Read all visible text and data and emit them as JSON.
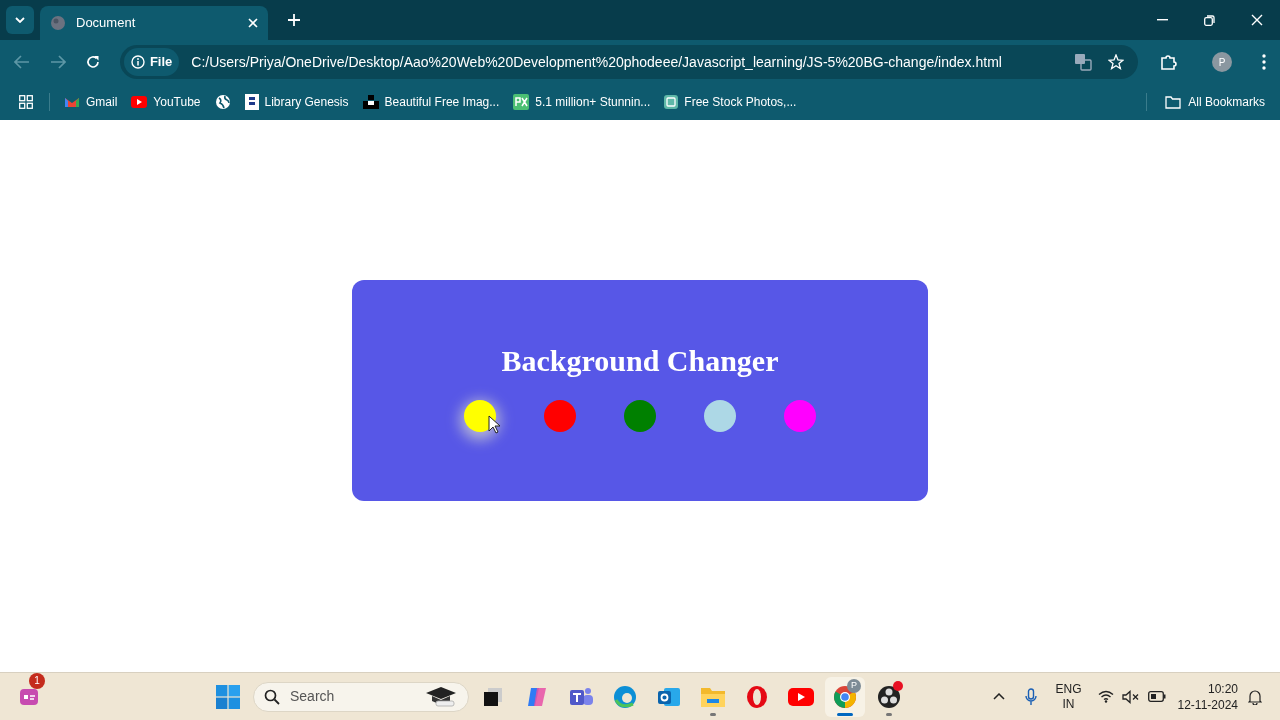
{
  "browser": {
    "tab": {
      "title": "Document"
    },
    "address": {
      "scheme": "File",
      "url": "C:/Users/Priya/OneDrive/Desktop/Aao%20Web%20Development%20phodeee/Javascript_learning/JS-5%20BG-change/index.html"
    },
    "profile": "P",
    "bookmarks": [
      {
        "kind": "gmail",
        "label": "Gmail"
      },
      {
        "kind": "youtube",
        "label": "YouTube"
      },
      {
        "kind": "globe"
      },
      {
        "kind": "book",
        "label": "Library Genesis"
      },
      {
        "kind": "unsplash",
        "label": "Beautiful Free Imag..."
      },
      {
        "kind": "px",
        "label": "5.1 million+ Stunnin..."
      },
      {
        "kind": "stock",
        "label": "Free Stock Photos,..."
      }
    ],
    "all_bookmarks": "All Bookmarks"
  },
  "card": {
    "title": "Background Changer",
    "swatches": [
      {
        "color": "#ffff00",
        "hovered": true
      },
      {
        "color": "#ff0000",
        "hovered": false
      },
      {
        "color": "#008000",
        "hovered": false
      },
      {
        "color": "#add8e6",
        "hovered": false
      },
      {
        "color": "#ff00ff",
        "hovered": false
      }
    ]
  },
  "taskbar": {
    "widget_badge": "1",
    "search": {
      "placeholder": "Search"
    },
    "apps": [
      {
        "kind": "taskview",
        "running": false,
        "active": false
      },
      {
        "kind": "copilot",
        "running": false,
        "active": false
      },
      {
        "kind": "teams",
        "running": false,
        "active": false
      },
      {
        "kind": "edge",
        "running": false,
        "active": false
      },
      {
        "kind": "outlook",
        "running": false,
        "active": false
      },
      {
        "kind": "folder",
        "running": true,
        "active": false
      },
      {
        "kind": "opera",
        "running": false,
        "active": false
      },
      {
        "kind": "youtube",
        "running": false,
        "active": false
      },
      {
        "kind": "chrome",
        "running": true,
        "active": true,
        "badge": "P"
      },
      {
        "kind": "obs",
        "running": true,
        "active": false
      }
    ],
    "language": "ENG",
    "region": "IN",
    "time": "10:20",
    "date": "12-11-2024"
  }
}
